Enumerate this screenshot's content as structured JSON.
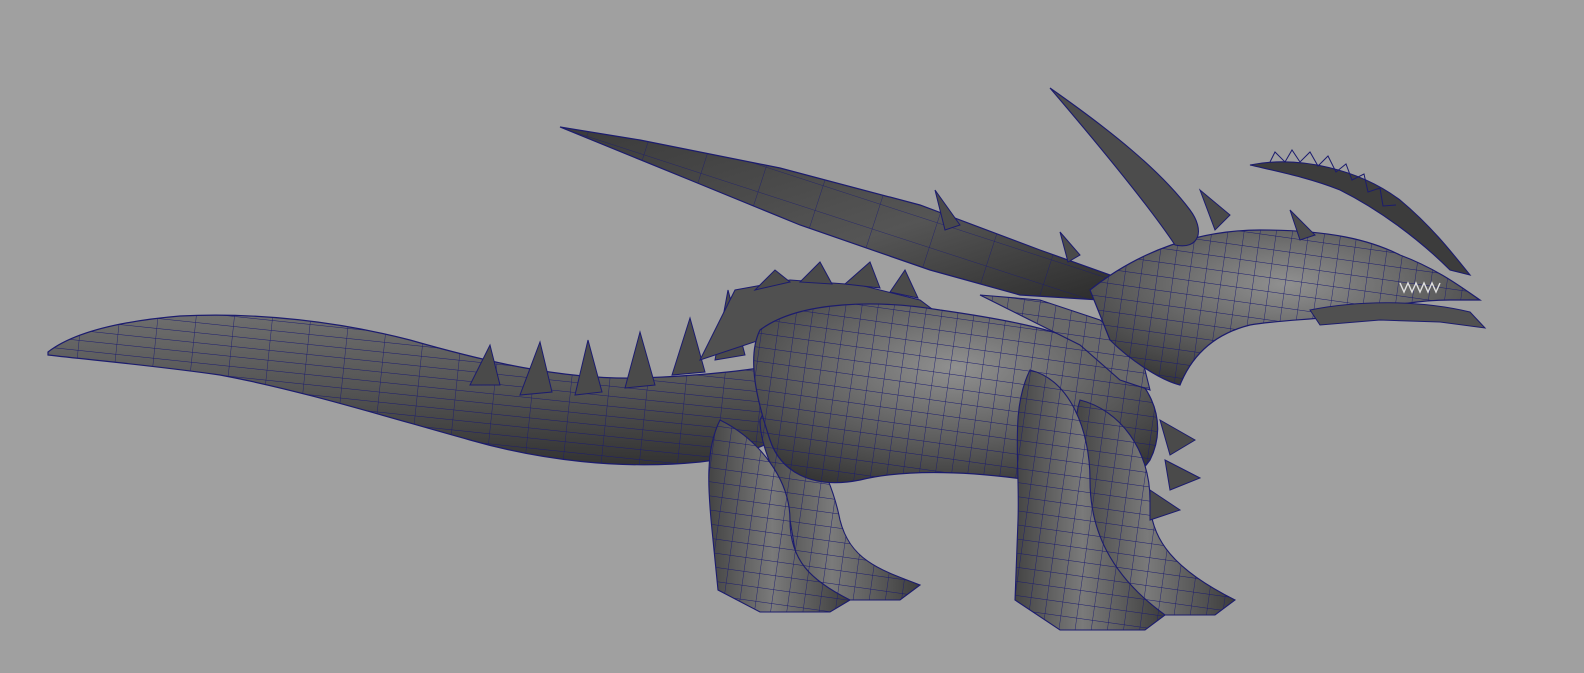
{
  "viewport": {
    "background": "#a0a0a0",
    "wireframe_color": "#1c1c6e",
    "shading_light": "#8e8e8e",
    "shading_dark": "#3a3a3a",
    "subject": "dragon-mesh"
  }
}
